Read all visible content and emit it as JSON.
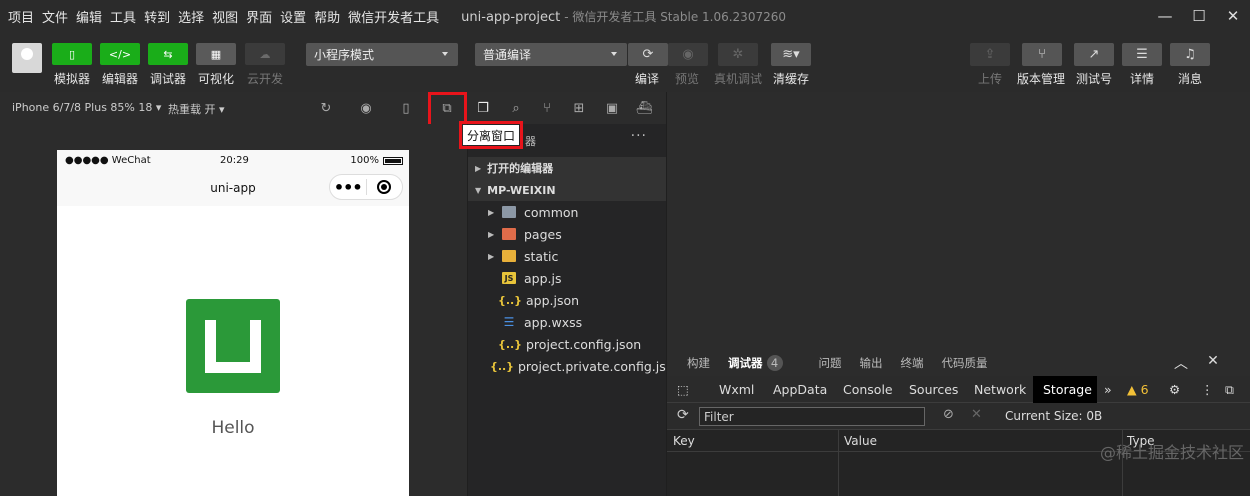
{
  "menubar": {
    "items": [
      "项目",
      "文件",
      "编辑",
      "工具",
      "转到",
      "选择",
      "视图",
      "界面",
      "设置",
      "帮助",
      "微信开发者工具"
    ],
    "title": "uni-app-project",
    "subtitle": "- 微信开发者工具 Stable 1.06.2307260"
  },
  "toolbar": {
    "simulator": "模拟器",
    "editor": "编辑器",
    "debugger": "调试器",
    "visual": "可视化",
    "cloud": "云开发",
    "mode_select": "小程序模式",
    "compile_select": "普通编译",
    "compile": "编译",
    "preview": "预览",
    "remote_debug": "真机调试",
    "clear_cache": "清缓存",
    "upload": "上传",
    "version": "版本管理",
    "test_account": "测试号",
    "details": "详情",
    "messages": "消息",
    "editor_icon_text": "</>"
  },
  "subbar": {
    "device": "iPhone 6/7/8 Plus 85% 18 ▾",
    "hot_reload": "热重载 开 ▾",
    "tooltip": "分离窗口"
  },
  "phone": {
    "signal": "●●●●● WeChat",
    "time": "20:29",
    "battery": "100%",
    "nav_title": "uni-app",
    "capsule_dots": "•••",
    "hello": "Hello"
  },
  "explorer": {
    "header": "器",
    "more": "···",
    "open_editors": "打开的编辑器",
    "project": "MP-WEIXIN",
    "items": [
      {
        "name": "common",
        "type": "folder"
      },
      {
        "name": "pages",
        "type": "folder-pages"
      },
      {
        "name": "static",
        "type": "folder-static"
      },
      {
        "name": "app.js",
        "type": "js"
      },
      {
        "name": "app.json",
        "type": "json"
      },
      {
        "name": "app.wxss",
        "type": "css"
      },
      {
        "name": "project.config.json",
        "type": "json"
      },
      {
        "name": "project.private.config.js...",
        "type": "json"
      }
    ]
  },
  "debug": {
    "tabs": [
      "构建",
      "调试器",
      "问题",
      "输出",
      "终端",
      "代码质量"
    ],
    "debugger_badge": "4",
    "panel_tabs": [
      "Wxml",
      "AppData",
      "Console",
      "Sources",
      "Network",
      "Storage"
    ],
    "more_tabs": "»",
    "warnings": "▲ 6",
    "filter_placeholder": "Filter",
    "current_size": "Current Size: 0B",
    "columns": [
      "Key",
      "Value",
      "Type"
    ]
  },
  "watermark": "@稀土掘金技术社区"
}
